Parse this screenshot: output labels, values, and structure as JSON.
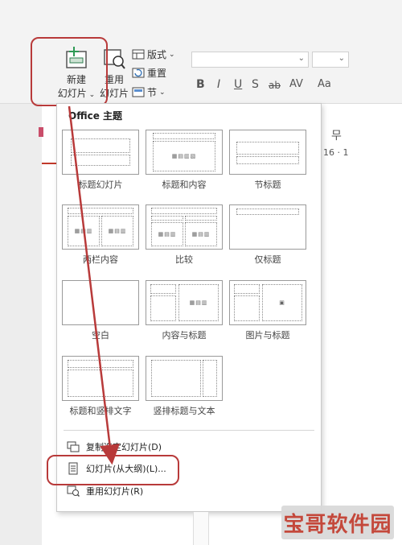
{
  "ribbon": {
    "new_slide": {
      "line1": "新建",
      "line2": "幻灯片"
    },
    "reuse_slide": {
      "line1": "重用",
      "line2": "幻灯片"
    },
    "layout": "版式",
    "reset": "重置",
    "section": "节",
    "format": {
      "bold": "B",
      "italic": "I",
      "underline": "U",
      "shadow": "S",
      "strike": "ab",
      "spacing": "AV",
      "case": "Aa"
    },
    "right_glyph": "무",
    "ruler": "16 · 1"
  },
  "gallery": {
    "title": "Office 主题",
    "layouts": [
      {
        "label": "标题幻灯片"
      },
      {
        "label": "标题和内容"
      },
      {
        "label": "节标题"
      },
      {
        "label": "两栏内容"
      },
      {
        "label": "比较"
      },
      {
        "label": "仅标题"
      },
      {
        "label": "空白"
      },
      {
        "label": "内容与标题"
      },
      {
        "label": "图片与标题"
      },
      {
        "label": "标题和竖排文字"
      },
      {
        "label": "竖排标题与文本"
      }
    ],
    "menu": [
      {
        "label": "复制选定幻灯片(D)",
        "icon": "duplicate-slide-icon"
      },
      {
        "label": "幻灯片(从大纲)(L)...",
        "icon": "outline-document-icon"
      },
      {
        "label": "重用幻灯片(R)",
        "icon": "reuse-slide-icon"
      }
    ]
  },
  "watermark": {
    "text": "宝哥软件园"
  },
  "colors": {
    "highlight": "#b83a3a",
    "accent_red": "#c0392b"
  }
}
